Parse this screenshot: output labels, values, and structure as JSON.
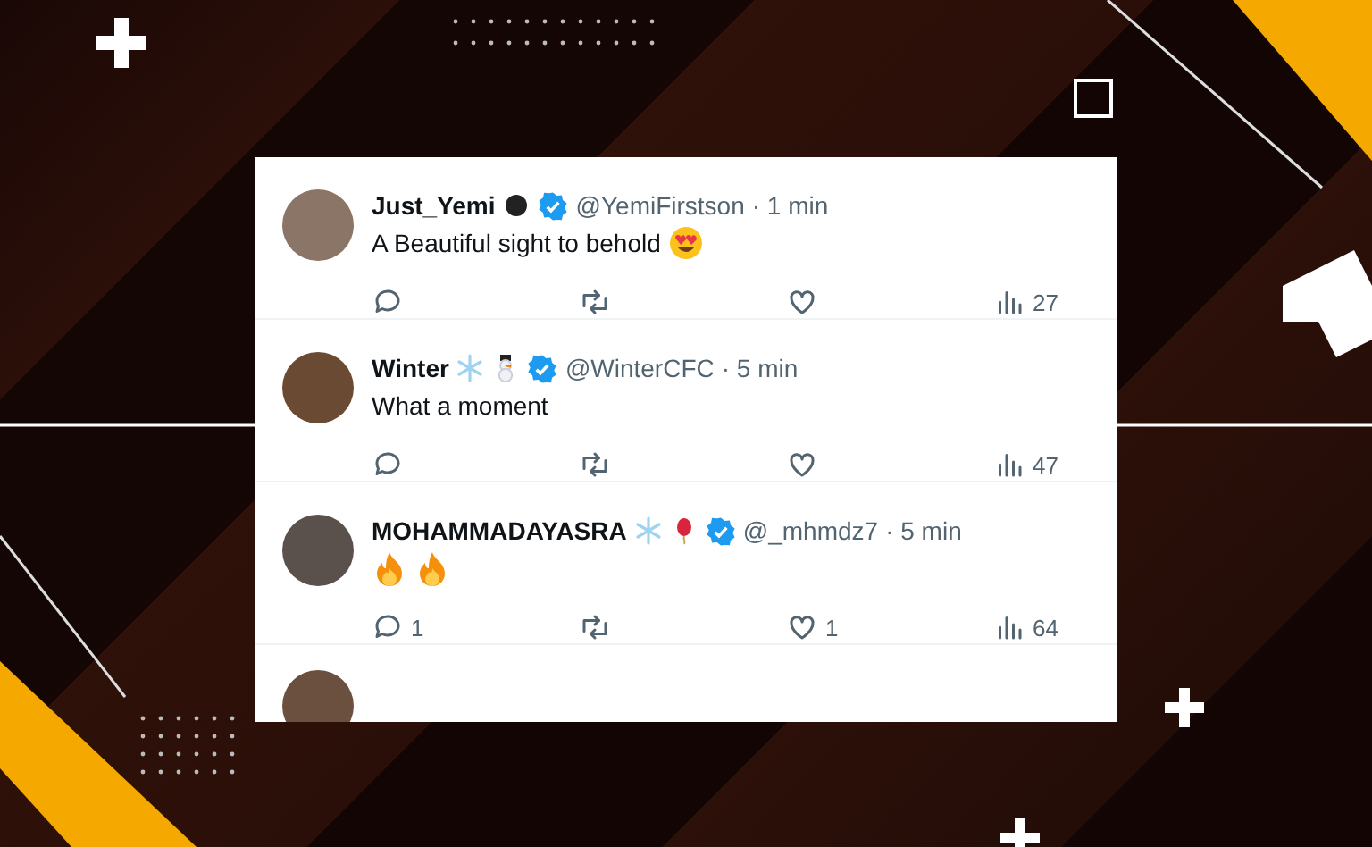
{
  "tweets": [
    {
      "name": "Just_Yemi",
      "name_emojis": [
        {
          "kind": "dark-circle"
        }
      ],
      "verified": true,
      "handle": "@YemiFirstson",
      "time": "· 1 min",
      "text": "A Beautiful sight to behold",
      "text_emojis": [
        {
          "kind": "heart-eyes"
        }
      ],
      "views": "27"
    },
    {
      "name": "Winter",
      "name_emojis": [
        {
          "kind": "snowflake"
        },
        {
          "kind": "snowman"
        }
      ],
      "verified": true,
      "handle": "@WinterCFC",
      "time": "· 5 min",
      "text": "What a moment",
      "views": "47"
    },
    {
      "name": "MOHAMMADAYASRA",
      "name_emojis": [
        {
          "kind": "snowflake"
        },
        {
          "kind": "balloon"
        }
      ],
      "verified": true,
      "handle": "@_mhmdz7",
      "time": "· 5 min",
      "text_emojis": [
        {
          "kind": "fire"
        },
        {
          "kind": "fire"
        }
      ],
      "replies": "1",
      "likes": "1",
      "views": "64"
    }
  ]
}
